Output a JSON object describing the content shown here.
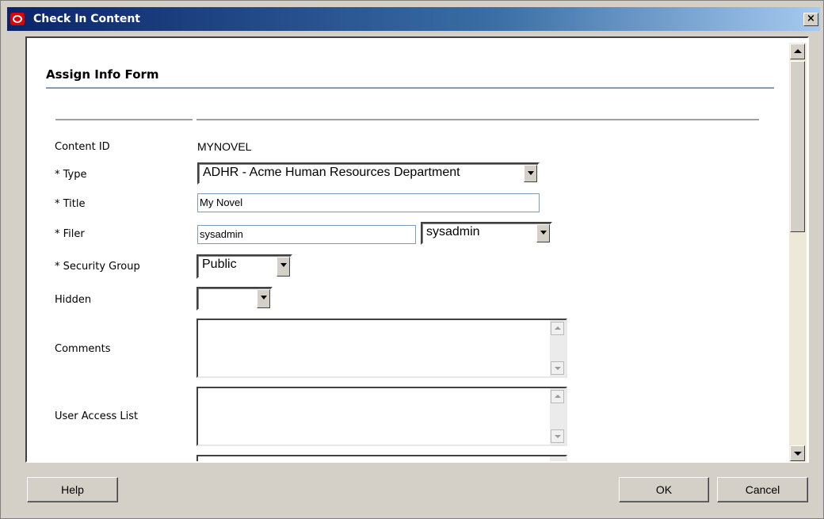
{
  "window": {
    "title": "Check In Content",
    "close_label": "×"
  },
  "form": {
    "heading": "Assign Info Form",
    "fields": {
      "content_id": {
        "label": "Content ID",
        "value": "MYNOVEL"
      },
      "type": {
        "label": "* Type",
        "value": "ADHR - Acme Human Resources Department"
      },
      "title": {
        "label": "* Title",
        "value": "My Novel"
      },
      "filer": {
        "label": "* Filer",
        "value": "sysadmin",
        "select_value": "sysadmin"
      },
      "security_group": {
        "label": "* Security Group",
        "value": "Public"
      },
      "hidden": {
        "label": "Hidden",
        "value": ""
      },
      "comments": {
        "label": "Comments",
        "value": ""
      },
      "user_access_list": {
        "label": "User Access List",
        "value": ""
      }
    }
  },
  "buttons": {
    "help": "Help",
    "ok": "OK",
    "cancel": "Cancel"
  },
  "icons": {
    "app": "oracle-logo-icon",
    "close": "close-icon"
  }
}
